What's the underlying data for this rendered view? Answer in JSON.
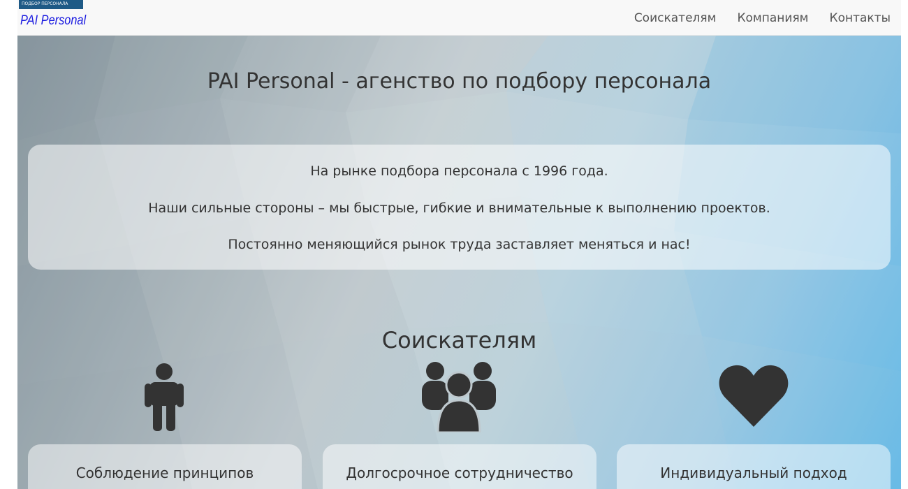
{
  "logo": {
    "tagline": "ПОДБОР ПЕРСОНАЛА",
    "name": "PAI Personal"
  },
  "nav": {
    "items": [
      {
        "label": "Соискателям"
      },
      {
        "label": "Компаниям"
      },
      {
        "label": "Контакты"
      }
    ]
  },
  "hero": {
    "title": "PAI Personal - агенство по подбору персонала",
    "intro": [
      "На рынке подбора персонала с 1996 года.",
      "Наши сильные стороны – мы быстрые, гибкие и внимательные к выполнению проектов.",
      "Постоянно меняющийся рынок труда заставляет меняться и нас!"
    ]
  },
  "section": {
    "title": "Соискателям",
    "features": [
      {
        "icon": "person-icon",
        "label": "Соблюдение принципов"
      },
      {
        "icon": "group-icon",
        "label": "Долгосрочное сотрудничество"
      },
      {
        "icon": "heart-icon",
        "label": "Индивидуальный подход"
      }
    ]
  },
  "colors": {
    "nav_bg": "#f8f8f8",
    "logo_strip": "#1e5a86",
    "logo_text": "#1a1ae0",
    "text": "#333333",
    "icon": "#333333",
    "accent_blue": "#5db7e7"
  }
}
